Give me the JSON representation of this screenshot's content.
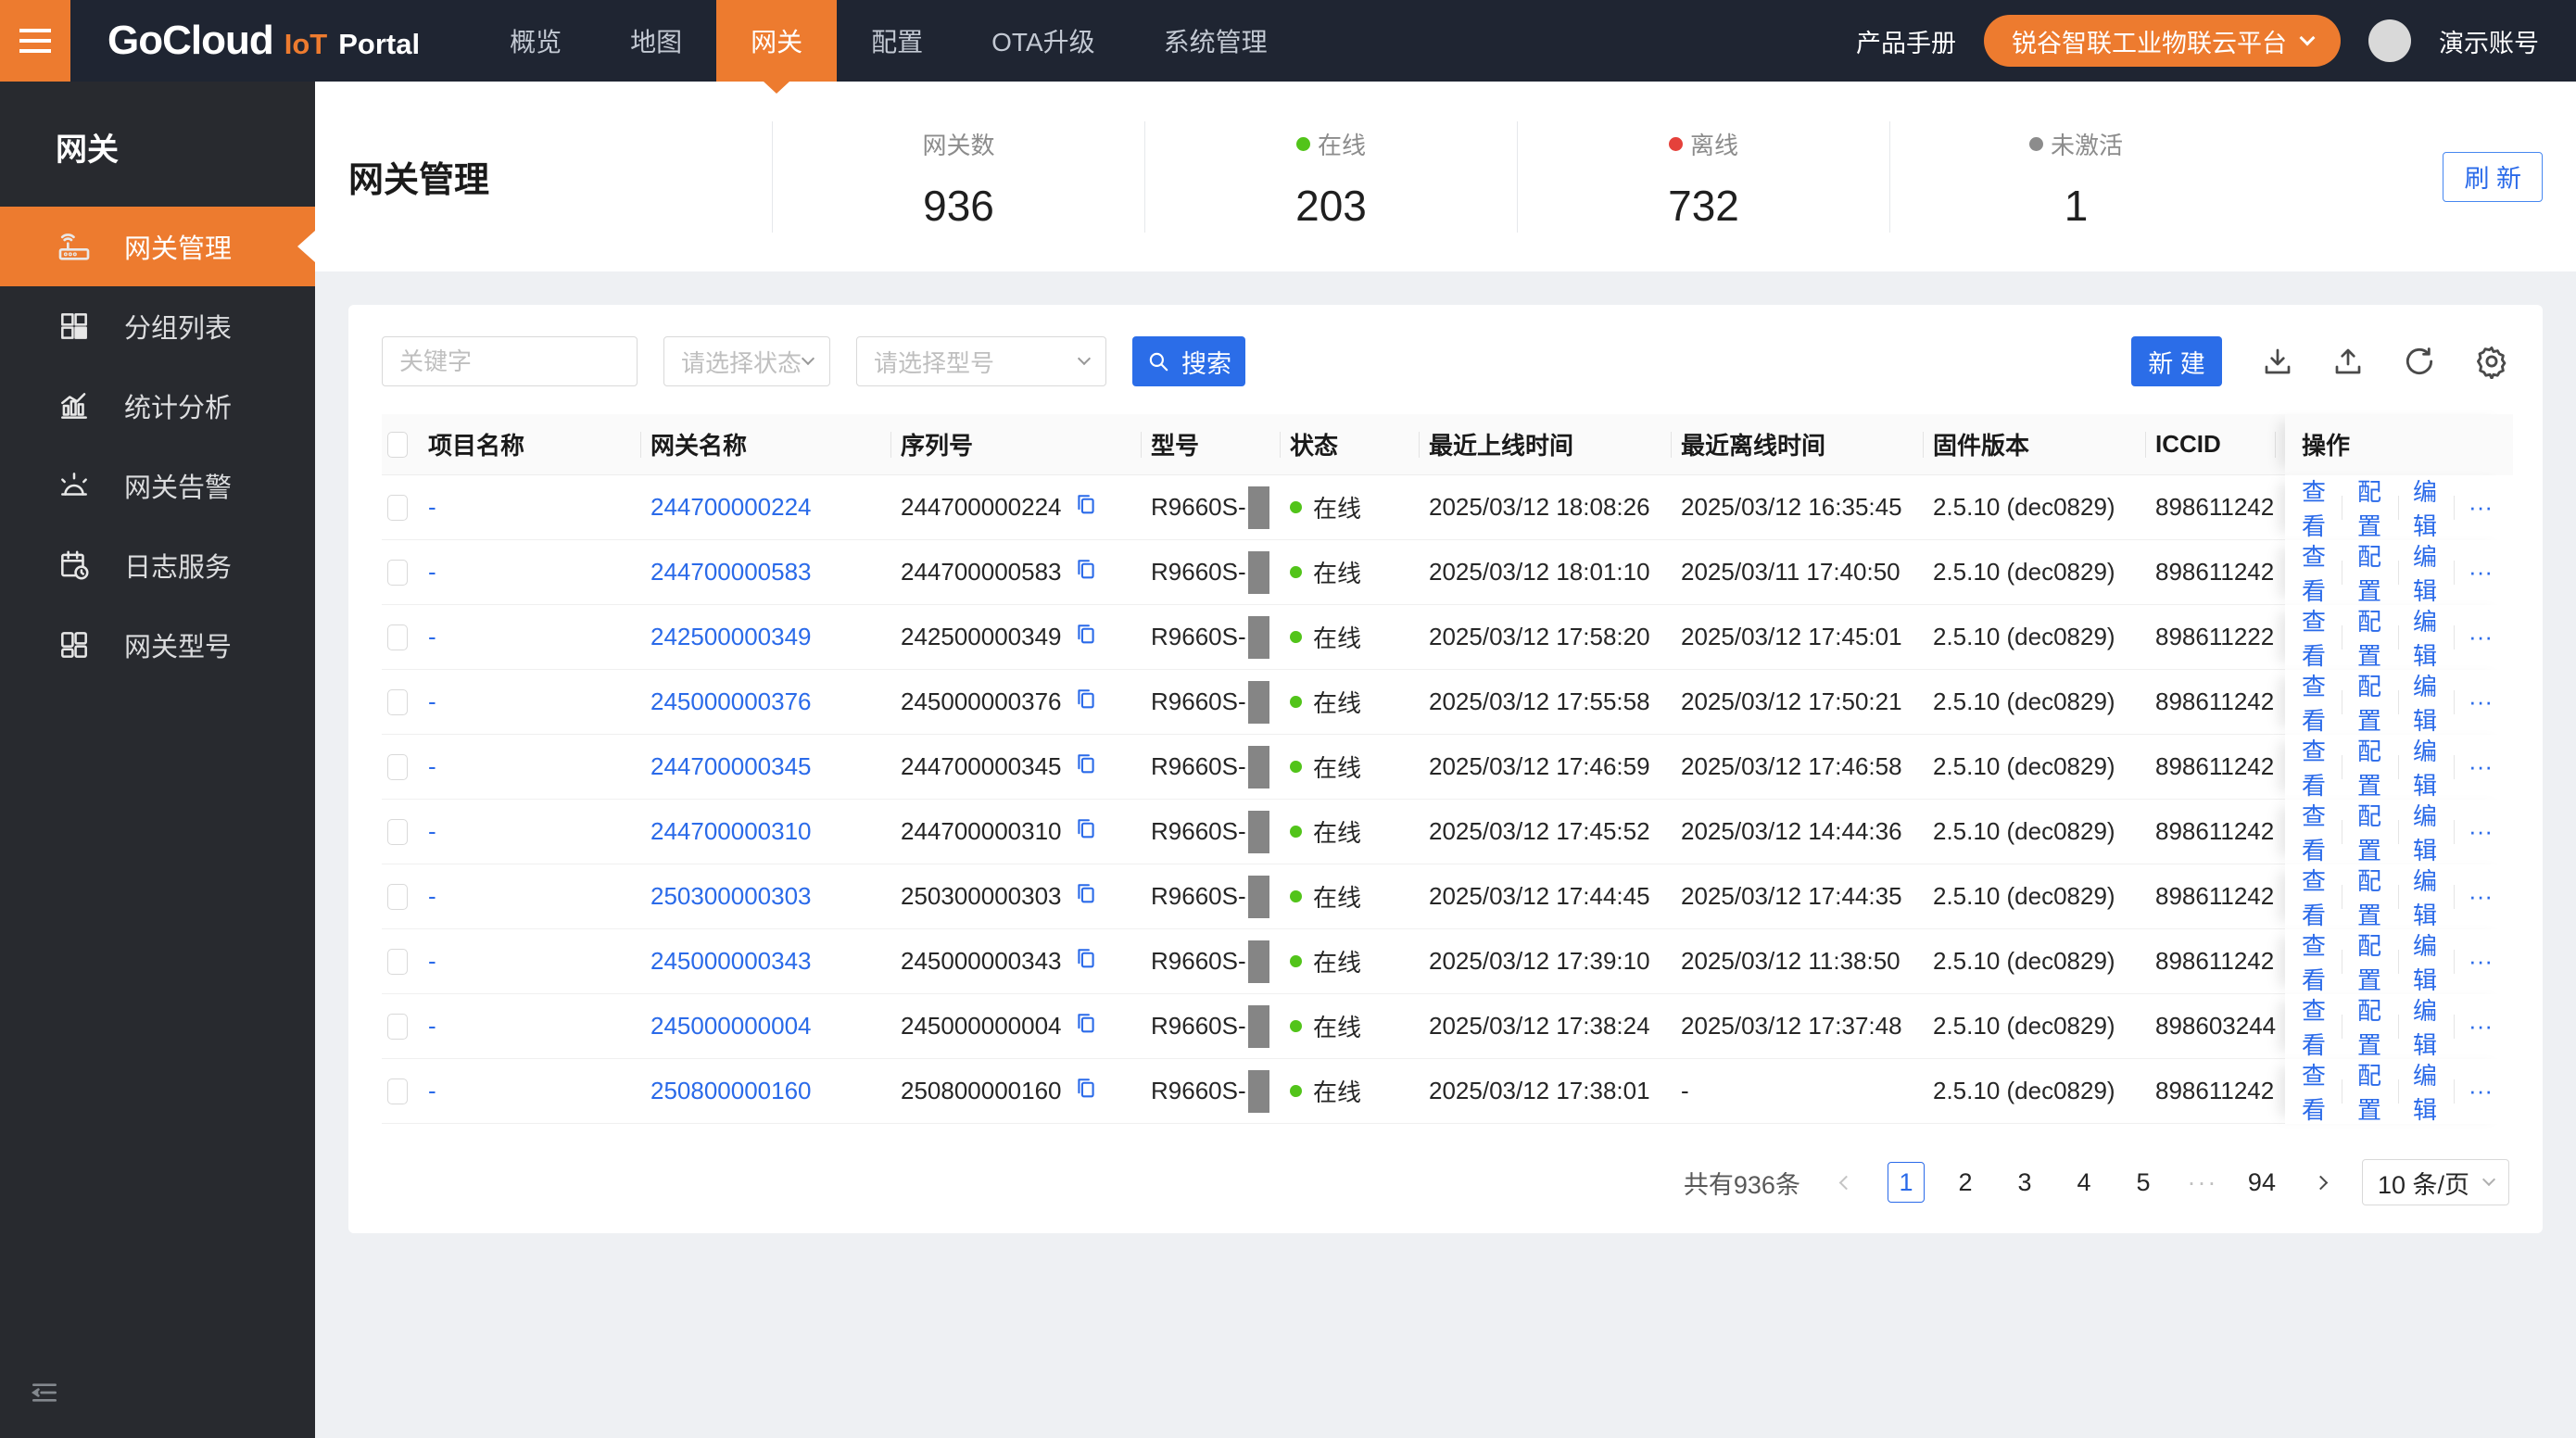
{
  "colors": {
    "accent_orange": "#ED7B2F",
    "primary_blue": "#2A6AE9",
    "online_green": "#52C41A",
    "offline_red": "#E5413B",
    "inactive_gray": "#8C8C8C"
  },
  "topbar": {
    "brand": {
      "name": "GoCloud",
      "mid": "IoT",
      "suffix": "Portal"
    },
    "nav": [
      {
        "label": "概览"
      },
      {
        "label": "地图"
      },
      {
        "label": "网关"
      },
      {
        "label": "配置"
      },
      {
        "label": "OTA升级"
      },
      {
        "label": "系统管理"
      }
    ],
    "manual": "产品手册",
    "platform": "锐谷智联工业物联云平台",
    "account": "演示账号"
  },
  "sidebar": {
    "title": "网关",
    "items": [
      {
        "label": "网关管理",
        "icon": "router-icon",
        "active": true
      },
      {
        "label": "分组列表",
        "icon": "group-grid-icon",
        "active": false
      },
      {
        "label": "统计分析",
        "icon": "chart-icon",
        "active": false
      },
      {
        "label": "网关告警",
        "icon": "alarm-icon",
        "active": false
      },
      {
        "label": "日志服务",
        "icon": "log-icon",
        "active": false
      },
      {
        "label": "网关型号",
        "icon": "model-grid-icon",
        "active": false
      }
    ]
  },
  "page": {
    "title": "网关管理",
    "stats": [
      {
        "label": "网关数",
        "value": "936",
        "dot": "none"
      },
      {
        "label": "在线",
        "value": "203",
        "dot": "#52C41A"
      },
      {
        "label": "离线",
        "value": "732",
        "dot": "#E5413B"
      },
      {
        "label": "未激活",
        "value": "1",
        "dot": "#8C8C8C"
      }
    ],
    "refresh_label": "刷 新"
  },
  "toolbar": {
    "keyword_placeholder": "关键字",
    "status_placeholder": "请选择状态",
    "model_placeholder": "请选择型号",
    "search_label": "搜索",
    "create_label": "新 建"
  },
  "table": {
    "headers": [
      "项目名称",
      "网关名称",
      "序列号",
      "型号",
      "状态",
      "最近上线时间",
      "最近离线时间",
      "固件版本",
      "ICCID",
      "操作"
    ],
    "actions": [
      "查看",
      "配置",
      "编辑",
      "···"
    ],
    "rows": [
      {
        "project": "-",
        "name": "244700000224",
        "serial": "244700000224",
        "model": "R9660S-",
        "status": "在线",
        "online": "2025/03/12 18:08:26",
        "offline": "2025/03/12 16:35:45",
        "firmware": "2.5.10 (dec0829)",
        "iccid": "898611242"
      },
      {
        "project": "-",
        "name": "244700000583",
        "serial": "244700000583",
        "model": "R9660S-",
        "status": "在线",
        "online": "2025/03/12 18:01:10",
        "offline": "2025/03/11 17:40:50",
        "firmware": "2.5.10 (dec0829)",
        "iccid": "898611242"
      },
      {
        "project": "-",
        "name": "242500000349",
        "serial": "242500000349",
        "model": "R9660S-",
        "status": "在线",
        "online": "2025/03/12 17:58:20",
        "offline": "2025/03/12 17:45:01",
        "firmware": "2.5.10 (dec0829)",
        "iccid": "898611222"
      },
      {
        "project": "-",
        "name": "245000000376",
        "serial": "245000000376",
        "model": "R9660S-",
        "status": "在线",
        "online": "2025/03/12 17:55:58",
        "offline": "2025/03/12 17:50:21",
        "firmware": "2.5.10 (dec0829)",
        "iccid": "898611242"
      },
      {
        "project": "-",
        "name": "244700000345",
        "serial": "244700000345",
        "model": "R9660S-",
        "status": "在线",
        "online": "2025/03/12 17:46:59",
        "offline": "2025/03/12 17:46:58",
        "firmware": "2.5.10 (dec0829)",
        "iccid": "898611242"
      },
      {
        "project": "-",
        "name": "244700000310",
        "serial": "244700000310",
        "model": "R9660S-",
        "status": "在线",
        "online": "2025/03/12 17:45:52",
        "offline": "2025/03/12 14:44:36",
        "firmware": "2.5.10 (dec0829)",
        "iccid": "898611242"
      },
      {
        "project": "-",
        "name": "250300000303",
        "serial": "250300000303",
        "model": "R9660S-",
        "status": "在线",
        "online": "2025/03/12 17:44:45",
        "offline": "2025/03/12 17:44:35",
        "firmware": "2.5.10 (dec0829)",
        "iccid": "898611242"
      },
      {
        "project": "-",
        "name": "245000000343",
        "serial": "245000000343",
        "model": "R9660S-",
        "status": "在线",
        "online": "2025/03/12 17:39:10",
        "offline": "2025/03/12 11:38:50",
        "firmware": "2.5.10 (dec0829)",
        "iccid": "898611242"
      },
      {
        "project": "-",
        "name": "245000000004",
        "serial": "245000000004",
        "model": "R9660S-",
        "status": "在线",
        "online": "2025/03/12 17:38:24",
        "offline": "2025/03/12 17:37:48",
        "firmware": "2.5.10 (dec0829)",
        "iccid": "898603244"
      },
      {
        "project": "-",
        "name": "250800000160",
        "serial": "250800000160",
        "model": "R9660S-",
        "status": "在线",
        "online": "2025/03/12 17:38:01",
        "offline": "-",
        "firmware": "2.5.10 (dec0829)",
        "iccid": "898611242"
      }
    ]
  },
  "pagination": {
    "total": "共有936条",
    "pages": [
      "1",
      "2",
      "3",
      "4",
      "5",
      "···",
      "94"
    ],
    "active_page": "1",
    "page_size": "10 条/页"
  }
}
